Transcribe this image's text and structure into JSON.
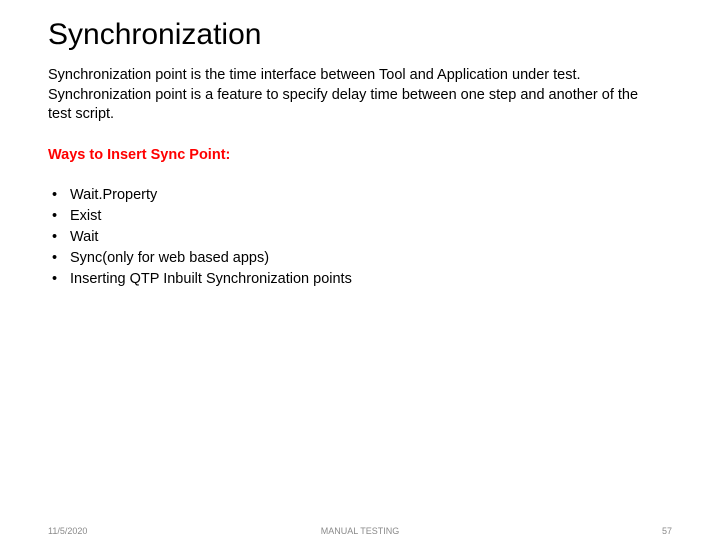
{
  "title": "Synchronization",
  "paragraph": "Synchronization point is the time interface between Tool and Application under test. Synchronization point is a feature to specify delay time between one step and another of the test script.",
  "subhead": "Ways to Insert Sync Point:",
  "bullets": [
    "Wait.Property",
    "Exist",
    "Wait",
    "Sync(only for web based apps)",
    "Inserting QTP Inbuilt Synchronization points"
  ],
  "footer": {
    "date": "11/5/2020",
    "center": "MANUAL TESTING",
    "page": "57"
  }
}
